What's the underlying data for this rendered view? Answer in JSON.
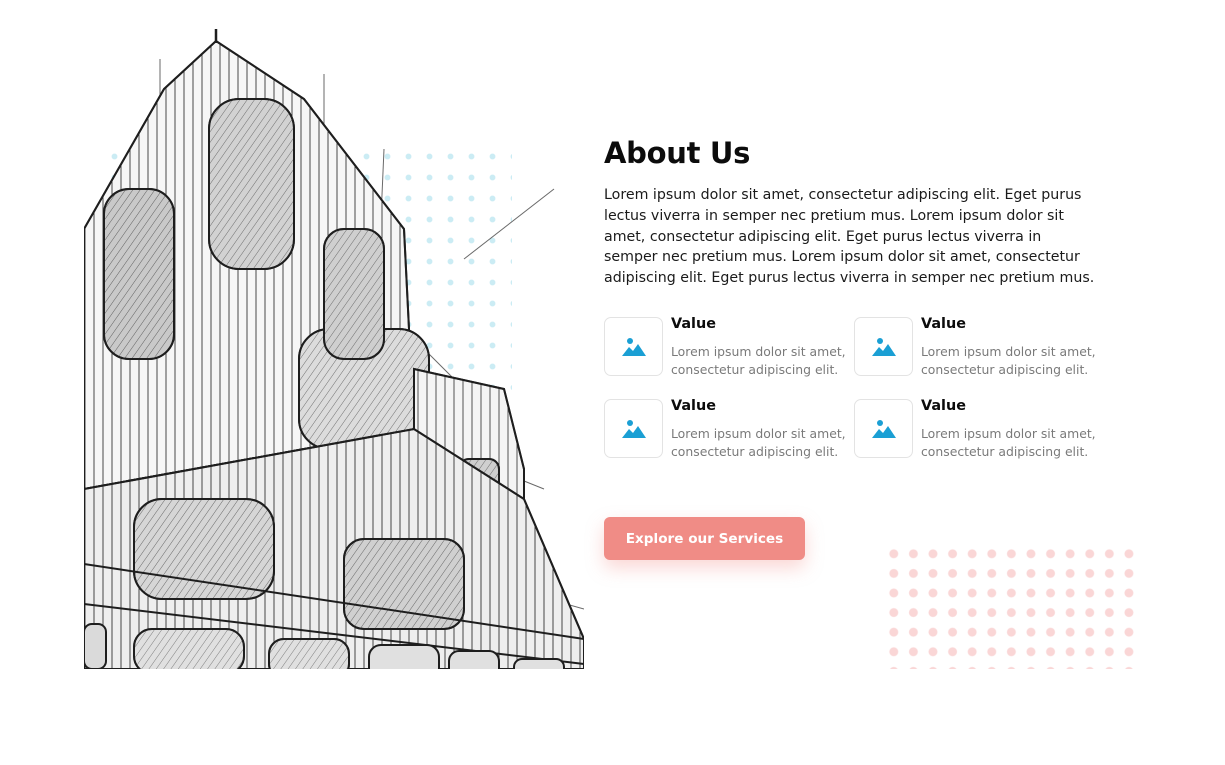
{
  "about": {
    "title": "About Us",
    "body": "Lorem ipsum dolor sit amet, consectetur adipiscing elit. Eget purus lectus viverra in semper nec pretium mus. Lorem ipsum dolor sit amet, consectetur adipiscing elit. Eget purus lectus viverra in semper nec pretium mus. Lorem ipsum dolor sit amet, consectetur adipiscing elit. Eget purus lectus viverra in semper nec pretium mus."
  },
  "values": [
    {
      "title": "Value",
      "desc": "Lorem ipsum dolor sit amet, consectetur adipiscing elit.",
      "icon": "image-icon"
    },
    {
      "title": "Value",
      "desc": "Lorem ipsum dolor sit amet, consectetur adipiscing elit.",
      "icon": "image-icon"
    },
    {
      "title": "Value",
      "desc": "Lorem ipsum dolor sit amet, consectetur adipiscing elit.",
      "icon": "image-icon"
    },
    {
      "title": "Value",
      "desc": "Lorem ipsum dolor sit amet, consectetur adipiscing elit.",
      "icon": "image-icon"
    }
  ],
  "cta": {
    "label": "Explore our Services"
  },
  "colors": {
    "accent": "#f08c86",
    "icon": "#1a9fd4",
    "dots_blue": "#a0dceb",
    "dots_pink": "#f5b4b4"
  },
  "illustration": {
    "subject": "building-sketch"
  }
}
